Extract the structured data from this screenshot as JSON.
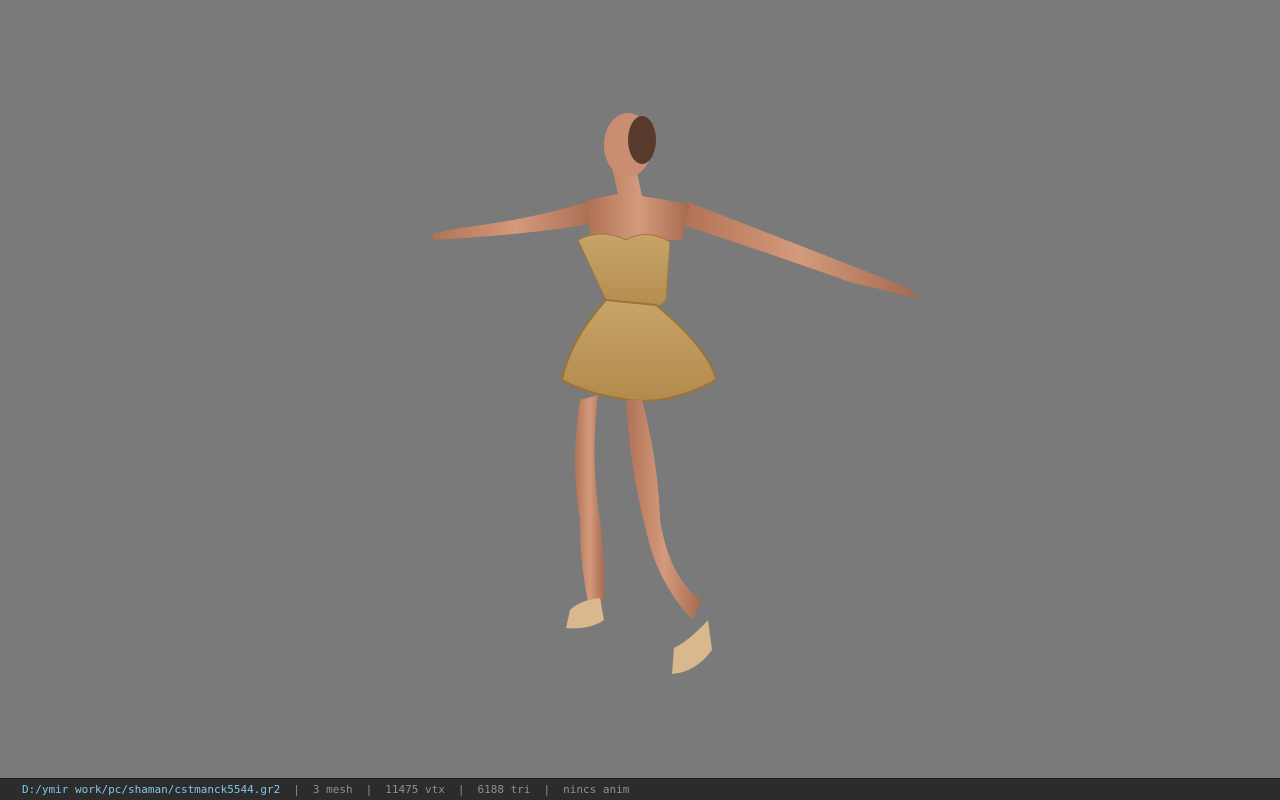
{
  "viewport": {
    "background": "#7a7a7a",
    "model_description_icon": "character-model"
  },
  "status": {
    "path": "D:/ymir work/pc/shaman/cstmanck5544.gr2",
    "separator": "|",
    "mesh": "3 mesh",
    "vertices": "11475 vtx",
    "triangles": "6188 tri",
    "anim": "nincs anim"
  },
  "colors": {
    "status_bar_bg": "#2c2c2c",
    "path_text": "#7fc6e8",
    "stat_text": "#8f8f8f"
  }
}
